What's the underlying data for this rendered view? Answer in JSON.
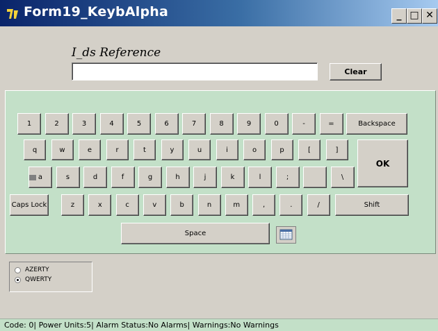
{
  "window": {
    "title": "Form19_KeybAlpha",
    "icon": "app-logo-icon",
    "controls": [
      "minimize-icon",
      "maximize-icon",
      "close-icon"
    ],
    "minimize_glyph": "_",
    "maximize_glyph": "□",
    "close_glyph": "✕"
  },
  "form": {
    "field_label": "I_ds Reference",
    "field_value": "",
    "clear_label": "Clear"
  },
  "keyboard": {
    "row1": [
      "1",
      "2",
      "3",
      "4",
      "5",
      "6",
      "7",
      "8",
      "9",
      "0",
      "-",
      "=",
      "Backspace"
    ],
    "row2": [
      "q",
      "w",
      "e",
      "r",
      "t",
      "y",
      "u",
      "i",
      "o",
      "p",
      "[",
      "]"
    ],
    "row3": [
      "a",
      "s",
      "d",
      "f",
      "g",
      "h",
      "j",
      "k",
      "l",
      ";",
      "",
      "\\"
    ],
    "row4": [
      "Caps Lock",
      "z",
      "x",
      "c",
      "v",
      "b",
      "n",
      "m",
      ",",
      ".",
      "/",
      "Shift"
    ],
    "ok_label": "OK",
    "space_label": "Space"
  },
  "layout_options": [
    {
      "label": "AZERTY",
      "checked": false
    },
    {
      "label": "QWERTY",
      "checked": true
    }
  ],
  "status": "Code: 0| Power Units:5| Alarm Status:No Alarms| Warnings:No Warnings",
  "colors": {
    "titlebar_start": "#0a246a",
    "titlebar_end": "#a6caf0",
    "keyboard_panel": "#c3e0c8",
    "window_bg": "#d4d0c8"
  }
}
